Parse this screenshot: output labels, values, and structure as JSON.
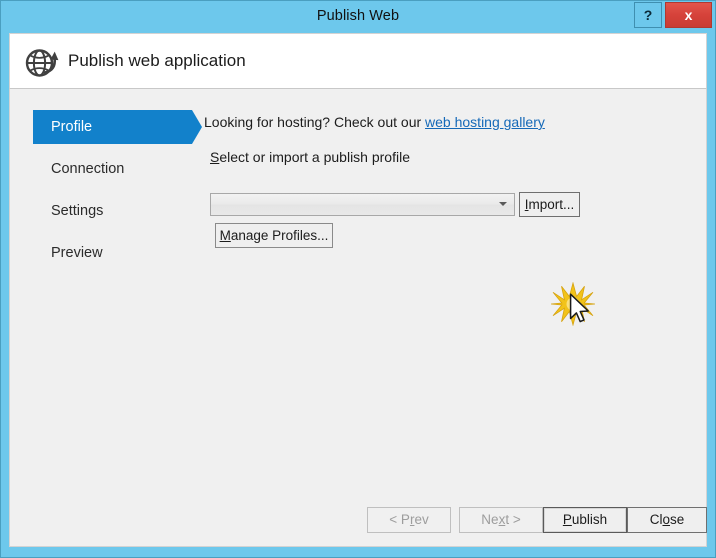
{
  "window": {
    "title": "Publish Web",
    "frame_color": "#6dc8ec",
    "help_label": "?",
    "close_label": "x",
    "close_color": "#d6423a"
  },
  "header": {
    "title": "Publish web application",
    "icon": "globe-publish-icon"
  },
  "sidebar": {
    "selected_color": "#1281cb",
    "items": [
      {
        "label": "Profile",
        "selected": true
      },
      {
        "label": "Connection",
        "selected": false
      },
      {
        "label": "Settings",
        "selected": false
      },
      {
        "label": "Preview",
        "selected": false
      }
    ]
  },
  "main": {
    "hosting_prefix": "Looking for hosting? Check out our ",
    "hosting_link": "web hosting gallery",
    "hosting_link_color": "#1569b8",
    "profile_label_accel": "S",
    "profile_label_rest": "elect or import a publish profile",
    "combo_value": "",
    "combo_placeholder": "",
    "import_accel": "I",
    "import_rest": "mport...",
    "manage_accel": "M",
    "manage_rest": "anage Profiles..."
  },
  "footer": {
    "prev": {
      "pre": "< P",
      "accel": "r",
      "post": "ev",
      "enabled": false
    },
    "next": {
      "pre": "Ne",
      "accel": "x",
      "post": "t >",
      "enabled": false
    },
    "publish": {
      "pre": "",
      "accel": "P",
      "post": "ublish",
      "enabled": true,
      "default": true
    },
    "close": {
      "pre": "Cl",
      "accel": "o",
      "post": "se",
      "enabled": true
    }
  }
}
